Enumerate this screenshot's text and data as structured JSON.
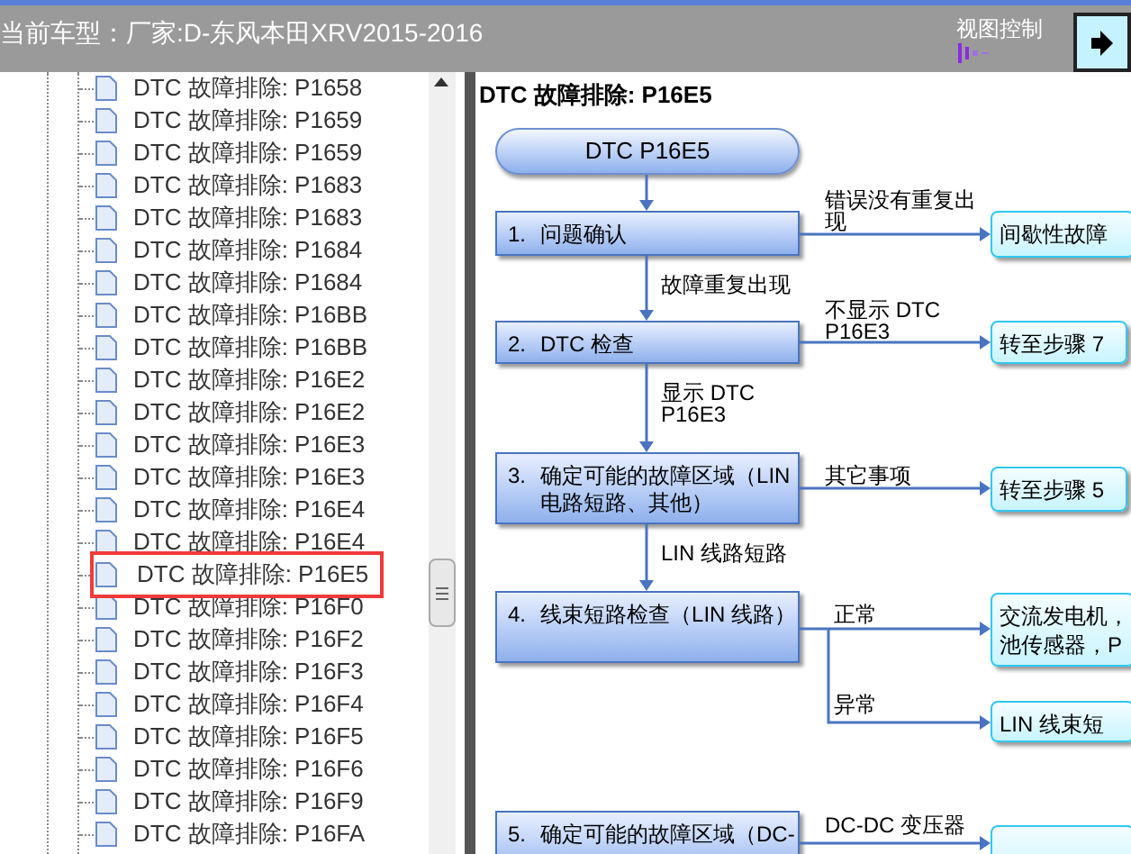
{
  "header": {
    "title": "当前车型：厂家:D-东风本田XRV2015-2016",
    "view_control": "视图控制"
  },
  "tree": {
    "items": [
      {
        "label": "DTC 故障排除: P1658",
        "selected": false
      },
      {
        "label": "DTC 故障排除: P1659",
        "selected": false
      },
      {
        "label": "DTC 故障排除: P1659",
        "selected": false
      },
      {
        "label": "DTC 故障排除: P1683",
        "selected": false
      },
      {
        "label": "DTC 故障排除: P1683",
        "selected": false
      },
      {
        "label": "DTC 故障排除: P1684",
        "selected": false
      },
      {
        "label": "DTC 故障排除: P1684",
        "selected": false
      },
      {
        "label": "DTC 故障排除: P16BB",
        "selected": false
      },
      {
        "label": "DTC 故障排除: P16BB",
        "selected": false
      },
      {
        "label": "DTC 故障排除: P16E2",
        "selected": false
      },
      {
        "label": "DTC 故障排除: P16E2",
        "selected": false
      },
      {
        "label": "DTC 故障排除: P16E3",
        "selected": false
      },
      {
        "label": "DTC 故障排除: P16E3",
        "selected": false
      },
      {
        "label": "DTC 故障排除: P16E4",
        "selected": false
      },
      {
        "label": "DTC 故障排除: P16E4",
        "selected": false
      },
      {
        "label": "DTC 故障排除: P16E5",
        "selected": true
      },
      {
        "label": "DTC 故障排除: P16F0",
        "selected": false
      },
      {
        "label": "DTC 故障排除: P16F2",
        "selected": false
      },
      {
        "label": "DTC 故障排除: P16F3",
        "selected": false
      },
      {
        "label": "DTC 故障排除: P16F4",
        "selected": false
      },
      {
        "label": "DTC 故障排除: P16F5",
        "selected": false
      },
      {
        "label": "DTC 故障排除: P16F6",
        "selected": false
      },
      {
        "label": "DTC 故障排除: P16F9",
        "selected": false
      },
      {
        "label": "DTC 故障排除: P16FA",
        "selected": false
      }
    ]
  },
  "document": {
    "title": "DTC 故障排除: P16E5",
    "flowchart": {
      "nodes": [
        {
          "kind": "start",
          "text": "DTC P16E5"
        },
        {
          "kind": "step",
          "num": "1.",
          "text": "问题确认"
        },
        {
          "kind": "step",
          "num": "2.",
          "text": "DTC 检查"
        },
        {
          "kind": "step",
          "num": "3.",
          "text": "确定可能的故障区域（LIN 电路短路、其他）"
        },
        {
          "kind": "step",
          "num": "4.",
          "text": "线束短路检查（LIN 线路）"
        },
        {
          "kind": "step",
          "num": "5.",
          "text": "确定可能的故障区域（DC-"
        },
        {
          "kind": "result",
          "text": "间歇性故障"
        },
        {
          "kind": "result",
          "text": "转至步骤 7"
        },
        {
          "kind": "result",
          "text": "转至步骤 5"
        },
        {
          "kind": "result",
          "text": "交流发电机，池传感器，P"
        },
        {
          "kind": "result",
          "text": "LIN 线束短"
        },
        {
          "kind": "result"
        }
      ],
      "labels": [
        "错误没有重复出现",
        "故障重复出现",
        "不显示 DTC P16E3",
        "显示 DTC P16E3",
        "其它事项",
        "LIN 线路短路",
        "正常",
        "异常",
        "DC-DC 变压器"
      ]
    }
  }
}
